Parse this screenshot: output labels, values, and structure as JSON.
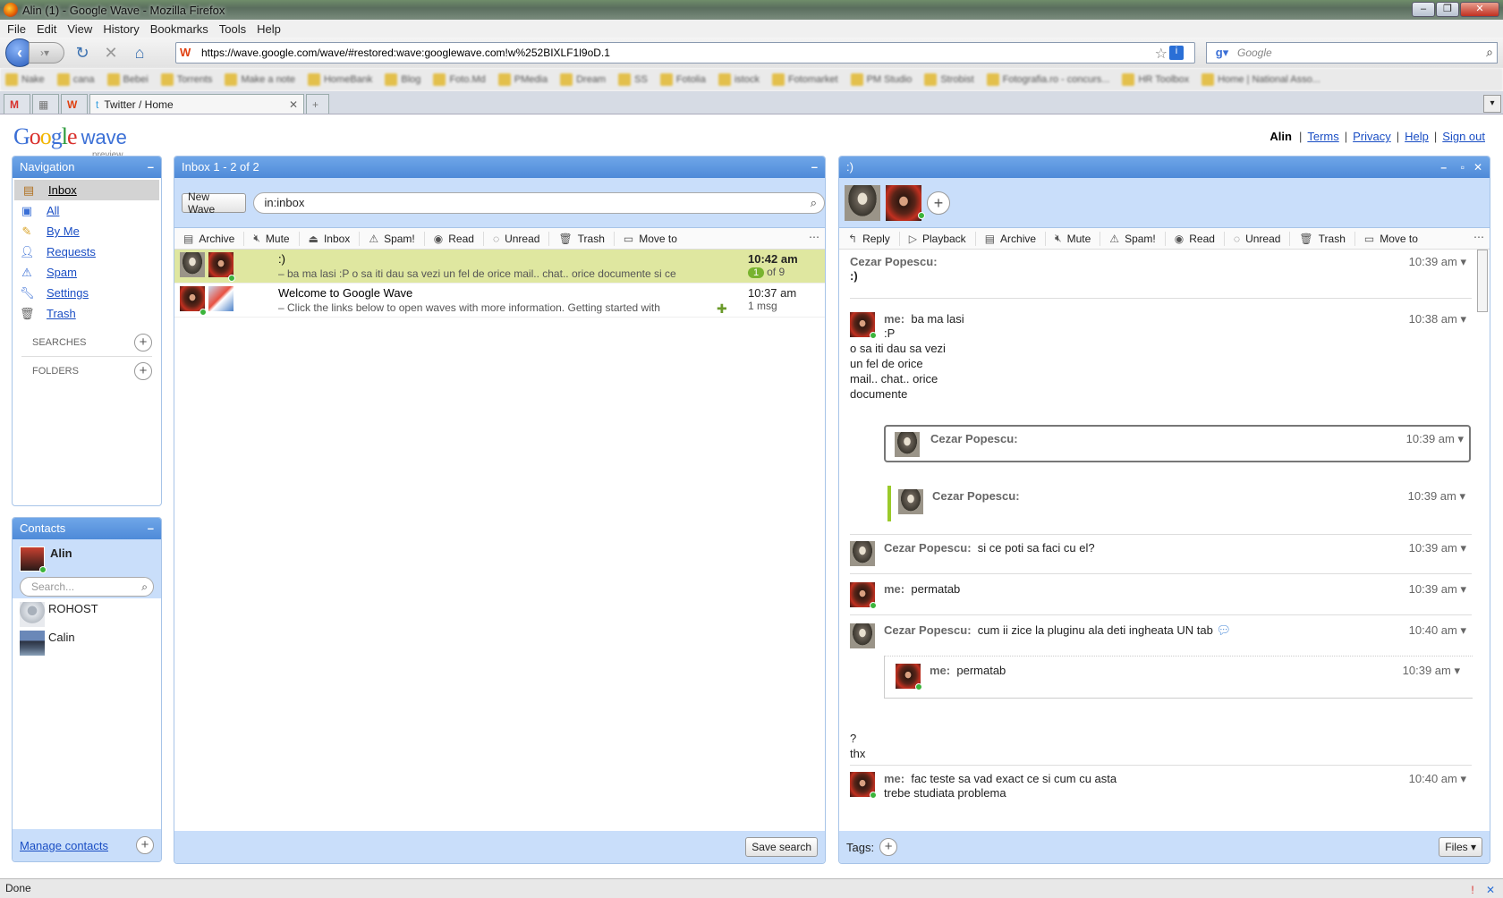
{
  "window": {
    "title": "Alin (1) - Google Wave - Mozilla Firefox"
  },
  "menu": [
    "File",
    "Edit",
    "View",
    "History",
    "Bookmarks",
    "Tools",
    "Help"
  ],
  "address": {
    "url": "https://wave.google.com/wave/#restored:wave:googlewave.com!w%252BIXLF1l9oD.1"
  },
  "browser_search": {
    "placeholder": "Google"
  },
  "bookmarks": [
    "Nake",
    "cana",
    "Bebei",
    "Torrents",
    "Make a note",
    "HomeBank",
    "Blog",
    "Foto.Md",
    "PMedia",
    "Dream",
    "SS",
    "Fotolia",
    "istock",
    "Fotomarket",
    "PM Studio",
    "Strobist",
    "Fotografia.ro - concurs...",
    "HR Toolbox",
    "Home | National Asso..."
  ],
  "tabs": [
    {
      "label": ""
    },
    {
      "label": ""
    },
    {
      "label": ""
    },
    {
      "label": "Twitter / Home"
    }
  ],
  "header": {
    "user": "Alin",
    "links": [
      "Terms",
      "Privacy",
      "Help",
      "Sign out"
    ],
    "logo_preview": "preview",
    "logo_wave": "wave"
  },
  "navigation": {
    "title": "Navigation",
    "items": [
      {
        "label": "Inbox"
      },
      {
        "label": "All"
      },
      {
        "label": "By Me"
      },
      {
        "label": "Requests"
      },
      {
        "label": "Spam"
      },
      {
        "label": "Settings"
      },
      {
        "label": "Trash"
      }
    ],
    "searches": "SEARCHES",
    "folders": "FOLDERS"
  },
  "contacts": {
    "title": "Contacts",
    "me": "Alin",
    "search_placeholder": "Search...",
    "list": [
      {
        "name": "ROHOST"
      },
      {
        "name": "Calin"
      }
    ],
    "manage": "Manage contacts"
  },
  "inbox": {
    "title": "Inbox 1 - 2 of 2",
    "new_wave": "New Wave",
    "query": "in:inbox",
    "toolbar": [
      "Archive",
      "Mute",
      "Inbox",
      "Spam!",
      "Read",
      "Unread",
      "Trash",
      "Move to"
    ],
    "rows": [
      {
        "title": ":)",
        "snippet": "– ba ma lasi :P o sa iti dau sa vezi un fel de orice mail.. chat.. orice documente si ce",
        "time": "10:42 am",
        "unread": "1",
        "count": "of 9"
      },
      {
        "title": "Welcome to Google Wave",
        "snippet": "– Click the links below to open waves with more information. Getting started with",
        "time": "10:37 am",
        "count": "1 msg"
      }
    ],
    "save_search": "Save search"
  },
  "wave": {
    "title": ":)",
    "toolbar": [
      "Reply",
      "Playback",
      "Archive",
      "Mute",
      "Spam!",
      "Read",
      "Unread",
      "Trash",
      "Move to"
    ],
    "blips": [
      {
        "author": "Cezar Popescu:",
        "time": "10:39 am",
        "text": ":)"
      },
      {
        "author": "me:",
        "time": "10:38 am",
        "lines": [
          "ba ma lasi",
          ":P",
          "o sa iti dau sa vezi",
          "un fel de orice",
          "mail.. chat.. orice",
          "documente"
        ]
      },
      {
        "author": "Cezar Popescu:",
        "time": "10:39 am",
        "text": ""
      },
      {
        "author": "Cezar Popescu:",
        "time": "10:39 am",
        "text": ""
      },
      {
        "author": "Cezar Popescu:",
        "time": "10:39 am",
        "text": "si ce poti sa faci cu el?"
      },
      {
        "author": "me:",
        "time": "10:39 am",
        "text": "permatab"
      },
      {
        "author": "Cezar Popescu:",
        "time": "10:40 am",
        "text": "cum ii zice la pluginu ala deti ingheata UN tab"
      },
      {
        "author": "me:",
        "time": "10:39 am",
        "text": "permatab"
      },
      {
        "author": "",
        "time": "",
        "lines": [
          "?",
          "thx"
        ]
      },
      {
        "author": "me:",
        "time": "10:40 am",
        "lines": [
          "fac teste sa vad exact ce si cum cu asta",
          "trebe studiata problema"
        ]
      }
    ],
    "tags_label": "Tags:",
    "files": "Files"
  },
  "status": {
    "text": "Done"
  }
}
